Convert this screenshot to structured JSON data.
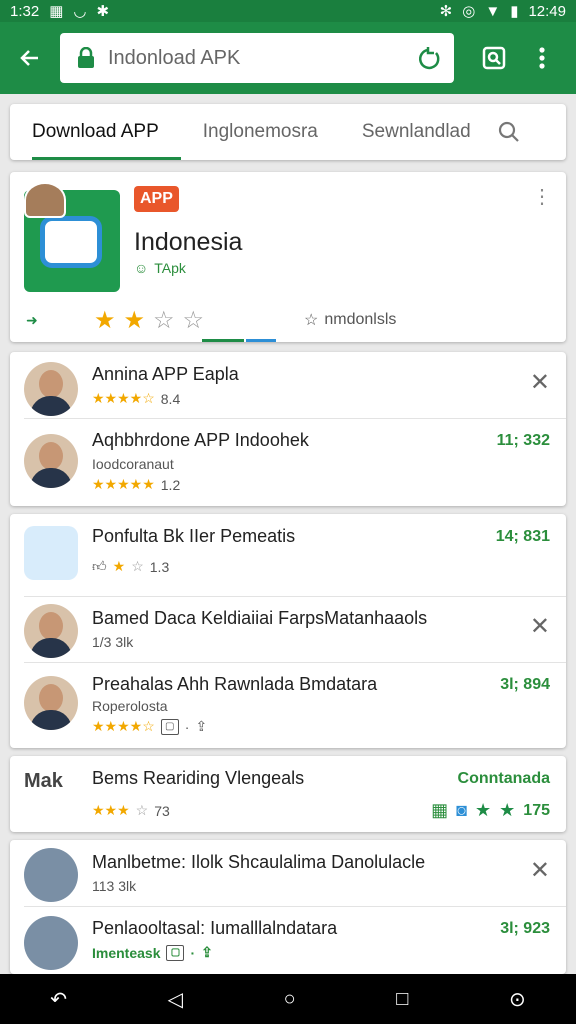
{
  "status": {
    "time": "1:32",
    "right_time": "12:49",
    "signal": "▲",
    "battery": "▮",
    "wifi": "▽"
  },
  "appbar": {
    "url": "Indonload APK"
  },
  "tabs": [
    "Download APP",
    "Inglonemosra",
    "Sewnlandlad"
  ],
  "hero": {
    "badge": "APP",
    "name": "Indonesia",
    "sub": "TApk",
    "rating_label": "nmdonlsls"
  },
  "card1": [
    {
      "title": "Annina APP Eapla",
      "rating": "3.4",
      "meta": "8.4",
      "right": ""
    },
    {
      "title": "Aqhbhrdone APP Indoohek",
      "sub": "Ioodcoranaut",
      "rating": "4.5",
      "meta": "1.2",
      "right": "11; 332"
    }
  ],
  "card2": [
    {
      "title": "Ponfulta Bk IIer Pemeatis",
      "meta": "1.3",
      "right": "14; 831"
    },
    {
      "title": "Bamed Daca Keldiaiiai FarpsMatanhaaols",
      "meta": "1/3 3lk",
      "right": ""
    },
    {
      "title": "Preahalas Ahh Rawnlada Bmdatara",
      "sub": "Roperolosta",
      "meta": "",
      "right": "3l; 894"
    }
  ],
  "card3": [
    {
      "title": "Bems Reariding Vlengeals",
      "meta": "73",
      "right": "Conntanada",
      "score": "175"
    }
  ],
  "card4": [
    {
      "title": "Manlbetme: Ilolk Shcaulalima Danolulacle",
      "meta": "113 3lk",
      "right": ""
    },
    {
      "title": "Penlaooltasal: Iumalllalndatara",
      "sub": "Imenteask",
      "meta": "",
      "right": "3l; 923"
    }
  ]
}
